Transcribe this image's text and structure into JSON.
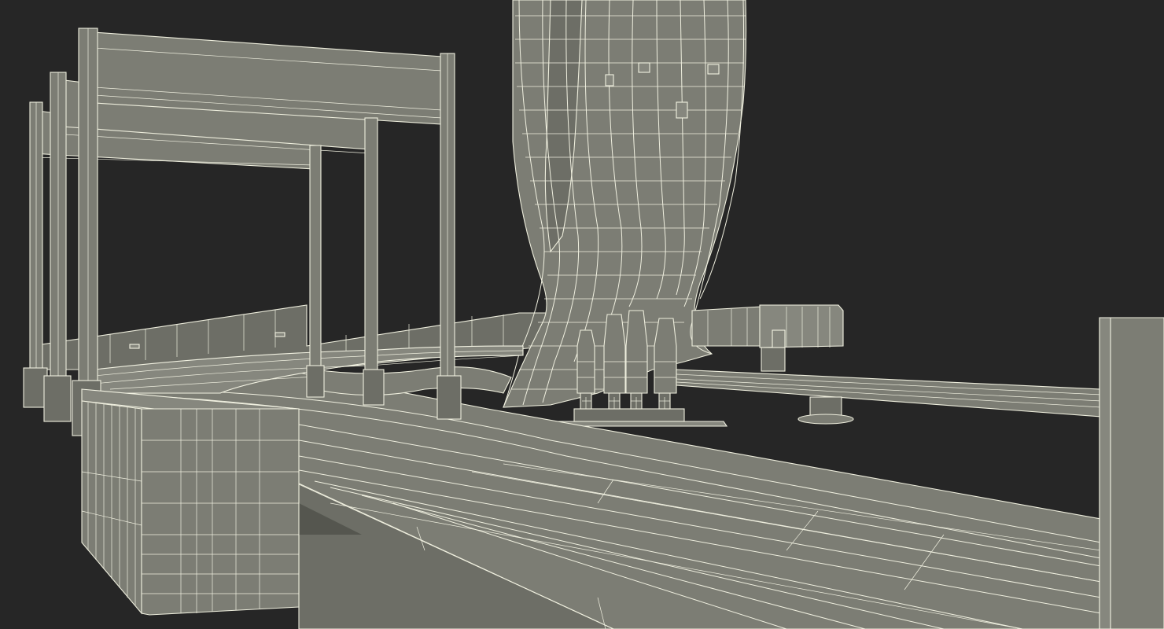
{
  "scene": {
    "description_visible_text": "",
    "colors": {
      "background": "#262626",
      "surface": "#7c7d74",
      "wireframe": "#eeeedd"
    },
    "objects": [
      "gantry-frame",
      "curved-loop-track",
      "straight-track",
      "side-block",
      "support-post",
      "right-panel"
    ]
  }
}
